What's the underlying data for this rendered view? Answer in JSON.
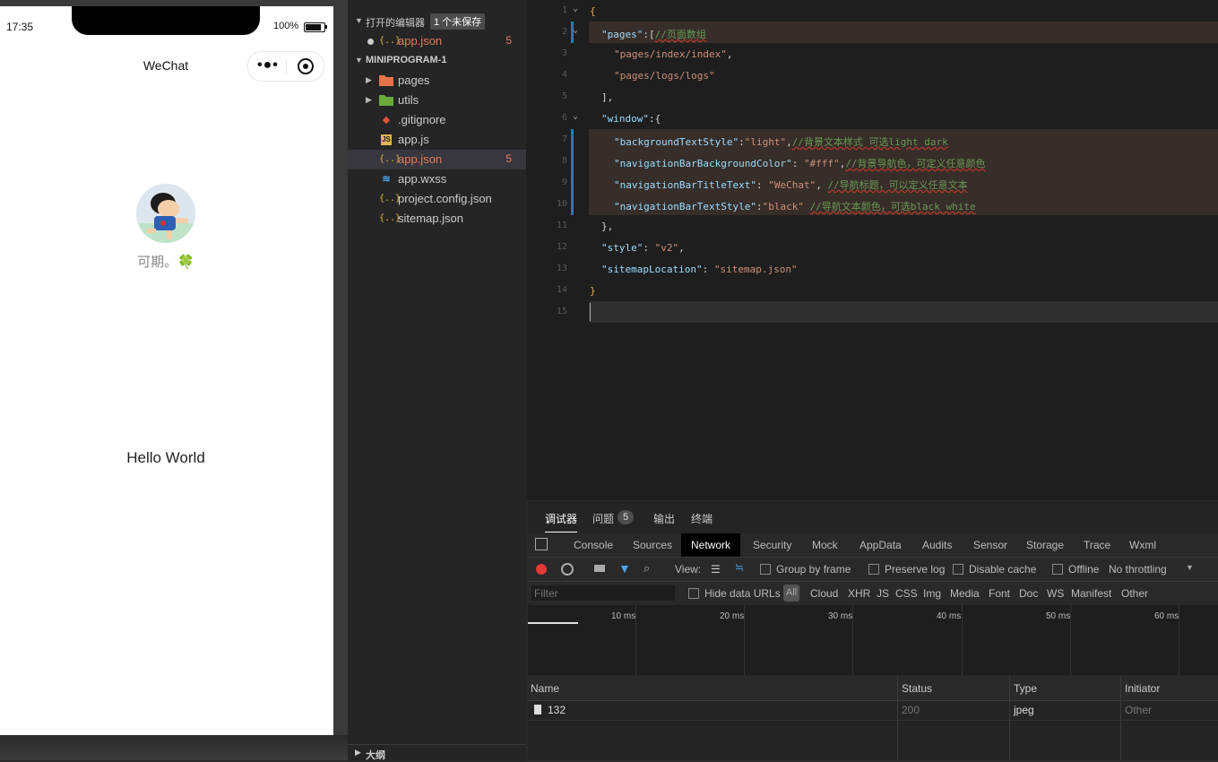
{
  "simulator": {
    "time": "17:35",
    "battery": "100%",
    "nav_title": "WeChat",
    "nickname": "可期。🍀",
    "hello": "Hello World"
  },
  "explorer": {
    "open_editors_label": "打开的编辑器",
    "unsaved_badge": "1 个未保存",
    "open_file": {
      "name": "app.json",
      "count": "5"
    },
    "project_label": "MINIPROGRAM-1",
    "items": [
      {
        "name": "pages",
        "type": "folder",
        "color": "#e8734a"
      },
      {
        "name": "utils",
        "type": "folder",
        "color": "#6aab3a"
      },
      {
        "name": ".gitignore",
        "type": "git"
      },
      {
        "name": "app.js",
        "type": "js"
      },
      {
        "name": "app.json",
        "type": "json",
        "count": "5",
        "selected": true
      },
      {
        "name": "app.wxss",
        "type": "css"
      },
      {
        "name": "project.config.json",
        "type": "json"
      },
      {
        "name": "sitemap.json",
        "type": "json"
      }
    ],
    "outline_label": "大纲"
  },
  "editor": {
    "line_numbers": [
      "1",
      "2",
      "3",
      "4",
      "5",
      "6",
      "7",
      "8",
      "9",
      "10",
      "11",
      "12",
      "13",
      "14",
      "15"
    ],
    "lines": {
      "l1": "{",
      "l2_key": "\"pages\"",
      "l2_rest": ":[",
      "l2_comment": "//页面数组",
      "l3": "\"pages/index/index\"",
      "l4": "\"pages/logs/logs\"",
      "l5": "],",
      "l6_key": "\"window\"",
      "l6_rest": ":{",
      "l7_key": "\"backgroundTextStyle\"",
      "l7_val": "\"light\"",
      "l7_comment": "//背景文本样式 可选light dark",
      "l8_key": "\"navigationBarBackgroundColor\"",
      "l8_val": "\"#fff\"",
      "l8_comment": "//背景导航色，可定义任意颜色",
      "l9_key": "\"navigationBarTitleText\"",
      "l9_val": "\"WeChat\"",
      "l9_comment": "//导航标题，可以定义任意文本",
      "l10_key": "\"navigationBarTextStyle\"",
      "l10_val": "\"black\"",
      "l10_comment": "//导航文本颜色，可选black white",
      "l11": "},",
      "l12_key": "\"style\"",
      "l12_val": "\"v2\"",
      "l13_key": "\"sitemapLocation\"",
      "l13_val": "\"sitemap.json\"",
      "l14": "}"
    }
  },
  "debug": {
    "tabs": [
      "调试器",
      "问题",
      "输出",
      "终端"
    ],
    "problems_count": "5",
    "devtools_tabs": [
      "Console",
      "Sources",
      "Network",
      "Security",
      "Mock",
      "AppData",
      "Audits",
      "Sensor",
      "Storage",
      "Trace",
      "Wxml"
    ],
    "active_devtools_tab": "Network",
    "view_label": "View:",
    "group_by_frame": "Group by frame",
    "preserve_log": "Preserve log",
    "disable_cache": "Disable cache",
    "offline": "Offline",
    "throttling": "No throttling",
    "filter_placeholder": "Filter",
    "hide_data_urls": "Hide data URLs",
    "all_label": "All",
    "type_filters": [
      "Cloud",
      "XHR",
      "JS",
      "CSS",
      "Img",
      "Media",
      "Font",
      "Doc",
      "WS",
      "Manifest",
      "Other"
    ],
    "timeline_labels": [
      "10 ms",
      "20 ms",
      "30 ms",
      "40 ms",
      "50 ms",
      "60 ms"
    ],
    "columns": [
      "Name",
      "Status",
      "Type",
      "Initiator"
    ],
    "rows": [
      {
        "name": "132",
        "status": "200",
        "type": "jpeg",
        "initiator": "Other"
      }
    ]
  }
}
